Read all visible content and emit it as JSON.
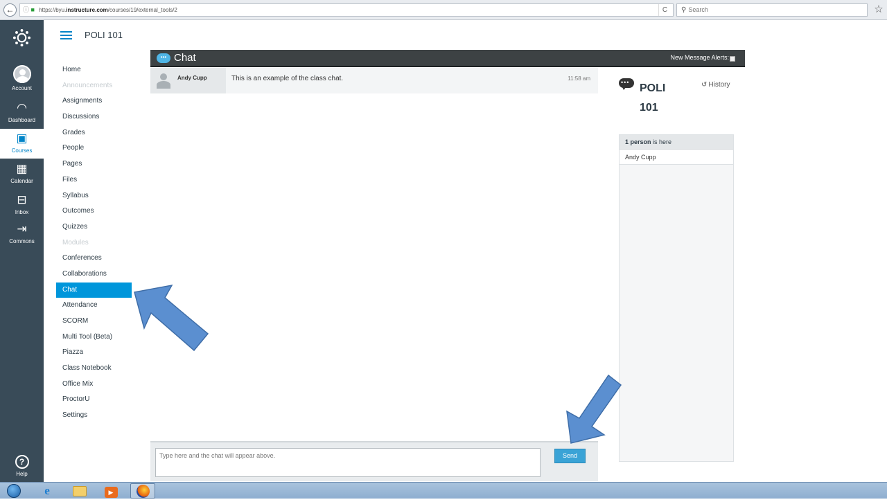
{
  "browser": {
    "url_prefix": "https://byu.",
    "url_domain": "instructure.com",
    "url_path": "/courses/19/external_tools/2",
    "search_placeholder": "Search",
    "back_glyph": "←",
    "reload_glyph": "C",
    "star_glyph": "☆"
  },
  "global_nav": {
    "items": [
      {
        "label": "Account",
        "icon": "account-icon"
      },
      {
        "label": "Dashboard",
        "icon": "dashboard-icon",
        "glyph": "◠"
      },
      {
        "label": "Courses",
        "icon": "courses-icon",
        "glyph": "▣"
      },
      {
        "label": "Calendar",
        "icon": "calendar-icon",
        "glyph": "▦"
      },
      {
        "label": "Inbox",
        "icon": "inbox-icon",
        "glyph": "⊟"
      },
      {
        "label": "Commons",
        "icon": "commons-icon",
        "glyph": "⇥"
      },
      {
        "label": "Help",
        "icon": "help-icon",
        "glyph": "?"
      }
    ],
    "active": "Courses"
  },
  "course": {
    "title": "POLI 101"
  },
  "course_nav": {
    "items": [
      {
        "label": "Home",
        "state": "normal"
      },
      {
        "label": "Announcements",
        "state": "disabled"
      },
      {
        "label": "Assignments",
        "state": "normal"
      },
      {
        "label": "Discussions",
        "state": "normal"
      },
      {
        "label": "Grades",
        "state": "normal"
      },
      {
        "label": "People",
        "state": "normal"
      },
      {
        "label": "Pages",
        "state": "normal"
      },
      {
        "label": "Files",
        "state": "normal"
      },
      {
        "label": "Syllabus",
        "state": "normal"
      },
      {
        "label": "Outcomes",
        "state": "normal"
      },
      {
        "label": "Quizzes",
        "state": "normal"
      },
      {
        "label": "Modules",
        "state": "disabled"
      },
      {
        "label": "Conferences",
        "state": "normal"
      },
      {
        "label": "Collaborations",
        "state": "normal"
      },
      {
        "label": "Chat",
        "state": "active"
      },
      {
        "label": "Attendance",
        "state": "normal"
      },
      {
        "label": "SCORM",
        "state": "normal"
      },
      {
        "label": "Multi Tool (Beta)",
        "state": "normal"
      },
      {
        "label": "Piazza",
        "state": "normal"
      },
      {
        "label": "Class Notebook",
        "state": "normal"
      },
      {
        "label": "Office Mix",
        "state": "normal"
      },
      {
        "label": "ProctorU",
        "state": "normal"
      },
      {
        "label": "Settings",
        "state": "normal"
      }
    ]
  },
  "chat": {
    "title": "Chat",
    "bubble_glyph": "•••",
    "alerts_label": "New Message Alerts:",
    "messages": [
      {
        "sender": "Andy Cupp",
        "text": "This is an example of the class chat.",
        "time": "11:58 am"
      }
    ],
    "input_placeholder": "Type here and the chat will appear above.",
    "send_label": "Send"
  },
  "room": {
    "name_line1": "POLI",
    "name_line2": "101",
    "history_label": "History",
    "history_glyph": "↺",
    "people_count_bold": "1 person",
    "people_count_rest": " is here",
    "people": [
      "Andy Cupp"
    ]
  },
  "colors": {
    "canvas_nav": "#394b58",
    "canvas_blue": "#0096db",
    "chat_header": "#3d4244",
    "arrow_fill": "#5b8fd0"
  },
  "taskbar": {
    "ie_glyph": "e",
    "media_glyph": "▶"
  }
}
